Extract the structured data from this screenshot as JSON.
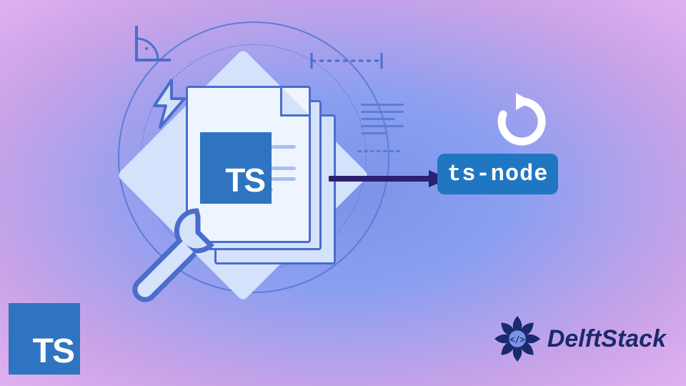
{
  "ts_logo_label": "TS",
  "ts_on_doc_label": "TS",
  "tsnode_label": "ts-node",
  "delftstack_text": "DelftStack",
  "colors": {
    "ts_blue": "#2f74c0",
    "tsnode_blue": "#2176c1",
    "accent": "#5a7dd8",
    "arrow": "#2b1f6f",
    "delft": "#1a2a6c"
  },
  "icons": {
    "angle": "angle-tool-icon",
    "lightning": "lightning-icon",
    "wrench": "wrench-icon",
    "arrow": "arrow-right-icon",
    "refresh": "refresh-icon",
    "document": "document-icon",
    "diamond": "diamond-shape-icon",
    "flower": "delftstack-flower-icon"
  }
}
